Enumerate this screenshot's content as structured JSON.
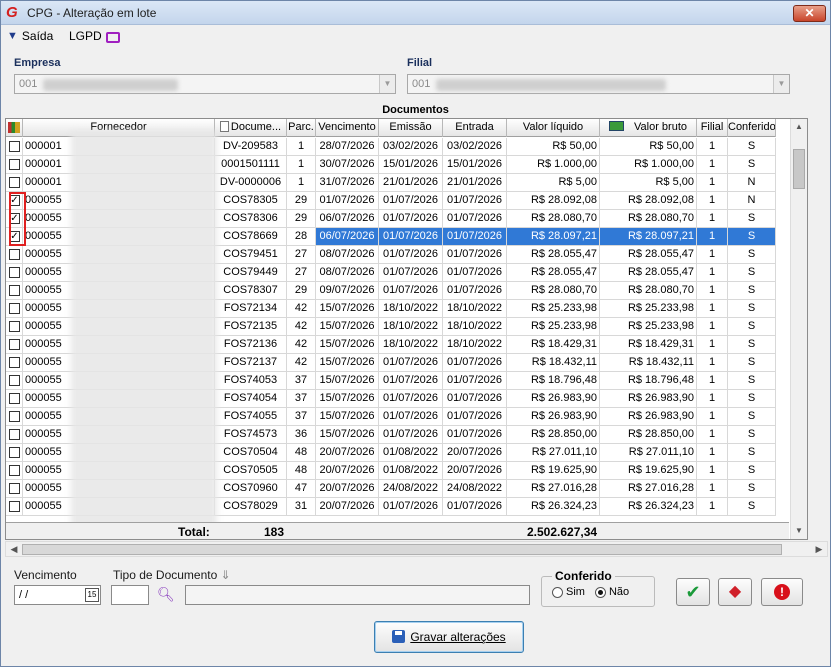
{
  "window": {
    "title": "CPG - Alteração em lote",
    "close_label": "✕",
    "app_icon_glyph": "G"
  },
  "menu": {
    "exit_label": "Saída",
    "lgpd_label": "LGPD"
  },
  "empresa": {
    "label": "Empresa",
    "value": "001"
  },
  "filial": {
    "label": "Filial",
    "value": "001"
  },
  "section_title": "Documentos",
  "table": {
    "headers": {
      "fornecedor": "Fornecedor",
      "documento": "Docume...",
      "parc": "Parc.",
      "vencimento": "Vencimento",
      "emissao": "Emissão",
      "entrada": "Entrada",
      "valor_liquido": "Valor líquido",
      "valor_bruto": "Valor bruto",
      "filial": "Filial",
      "conferido": "Conferido"
    },
    "rows": [
      {
        "checked": false,
        "forn": "000001",
        "doc": "DV-209583",
        "parc": "1",
        "venc": "28/07/2026",
        "emis": "03/02/2026",
        "entr": "03/02/2026",
        "vliq": "R$ 50,00",
        "vbru": "R$ 50,00",
        "fil": "1",
        "conf": "S"
      },
      {
        "checked": false,
        "forn": "000001",
        "doc": "0001501111",
        "parc": "1",
        "venc": "30/07/2026",
        "emis": "15/01/2026",
        "entr": "15/01/2026",
        "vliq": "R$ 1.000,00",
        "vbru": "R$ 1.000,00",
        "fil": "1",
        "conf": "S"
      },
      {
        "checked": false,
        "forn": "000001",
        "doc": "DV-0000006",
        "parc": "1",
        "venc": "31/07/2026",
        "emis": "21/01/2026",
        "entr": "21/01/2026",
        "vliq": "R$ 5,00",
        "vbru": "R$ 5,00",
        "fil": "1",
        "conf": "N"
      },
      {
        "checked": true,
        "forn": "000055",
        "doc": "COS78305",
        "parc": "29",
        "venc": "01/07/2026",
        "emis": "01/07/2026",
        "entr": "01/07/2026",
        "vliq": "R$ 28.092,08",
        "vbru": "R$ 28.092,08",
        "fil": "1",
        "conf": "N"
      },
      {
        "checked": true,
        "forn": "000055",
        "doc": "COS78306",
        "parc": "29",
        "venc": "06/07/2026",
        "emis": "01/07/2026",
        "entr": "01/07/2026",
        "vliq": "R$ 28.080,70",
        "vbru": "R$ 28.080,70",
        "fil": "1",
        "conf": "S"
      },
      {
        "checked": true,
        "selected": true,
        "forn": "000055",
        "doc": "COS78669",
        "parc": "28",
        "venc": "06/07/2026",
        "emis": "01/07/2026",
        "entr": "01/07/2026",
        "vliq": "R$ 28.097,21",
        "vbru": "R$ 28.097,21",
        "fil": "1",
        "conf": "S"
      },
      {
        "checked": false,
        "forn": "000055",
        "doc": "COS79451",
        "parc": "27",
        "venc": "08/07/2026",
        "emis": "01/07/2026",
        "entr": "01/07/2026",
        "vliq": "R$ 28.055,47",
        "vbru": "R$ 28.055,47",
        "fil": "1",
        "conf": "S"
      },
      {
        "checked": false,
        "forn": "000055",
        "doc": "COS79449",
        "parc": "27",
        "venc": "08/07/2026",
        "emis": "01/07/2026",
        "entr": "01/07/2026",
        "vliq": "R$ 28.055,47",
        "vbru": "R$ 28.055,47",
        "fil": "1",
        "conf": "S"
      },
      {
        "checked": false,
        "forn": "000055",
        "doc": "COS78307",
        "parc": "29",
        "venc": "09/07/2026",
        "emis": "01/07/2026",
        "entr": "01/07/2026",
        "vliq": "R$ 28.080,70",
        "vbru": "R$ 28.080,70",
        "fil": "1",
        "conf": "S"
      },
      {
        "checked": false,
        "forn": "000055",
        "doc": "FOS72134",
        "parc": "42",
        "venc": "15/07/2026",
        "emis": "18/10/2022",
        "entr": "18/10/2022",
        "vliq": "R$ 25.233,98",
        "vbru": "R$ 25.233,98",
        "fil": "1",
        "conf": "S"
      },
      {
        "checked": false,
        "forn": "000055",
        "doc": "FOS72135",
        "parc": "42",
        "venc": "15/07/2026",
        "emis": "18/10/2022",
        "entr": "18/10/2022",
        "vliq": "R$ 25.233,98",
        "vbru": "R$ 25.233,98",
        "fil": "1",
        "conf": "S"
      },
      {
        "checked": false,
        "forn": "000055",
        "doc": "FOS72136",
        "parc": "42",
        "venc": "15/07/2026",
        "emis": "18/10/2022",
        "entr": "18/10/2022",
        "vliq": "R$ 18.429,31",
        "vbru": "R$ 18.429,31",
        "fil": "1",
        "conf": "S"
      },
      {
        "checked": false,
        "forn": "000055",
        "doc": "FOS72137",
        "parc": "42",
        "venc": "15/07/2026",
        "emis": "01/07/2026",
        "entr": "01/07/2026",
        "vliq": "R$ 18.432,11",
        "vbru": "R$ 18.432,11",
        "fil": "1",
        "conf": "S"
      },
      {
        "checked": false,
        "forn": "000055",
        "doc": "FOS74053",
        "parc": "37",
        "venc": "15/07/2026",
        "emis": "01/07/2026",
        "entr": "01/07/2026",
        "vliq": "R$ 18.796,48",
        "vbru": "R$ 18.796,48",
        "fil": "1",
        "conf": "S"
      },
      {
        "checked": false,
        "forn": "000055",
        "doc": "FOS74054",
        "parc": "37",
        "venc": "15/07/2026",
        "emis": "01/07/2026",
        "entr": "01/07/2026",
        "vliq": "R$ 26.983,90",
        "vbru": "R$ 26.983,90",
        "fil": "1",
        "conf": "S"
      },
      {
        "checked": false,
        "forn": "000055",
        "doc": "FOS74055",
        "parc": "37",
        "venc": "15/07/2026",
        "emis": "01/07/2026",
        "entr": "01/07/2026",
        "vliq": "R$ 26.983,90",
        "vbru": "R$ 26.983,90",
        "fil": "1",
        "conf": "S"
      },
      {
        "checked": false,
        "forn": "000055",
        "doc": "FOS74573",
        "parc": "36",
        "venc": "15/07/2026",
        "emis": "01/07/2026",
        "entr": "01/07/2026",
        "vliq": "R$ 28.850,00",
        "vbru": "R$ 28.850,00",
        "fil": "1",
        "conf": "S"
      },
      {
        "checked": false,
        "forn": "000055",
        "doc": "COS70504",
        "parc": "48",
        "venc": "20/07/2026",
        "emis": "01/08/2022",
        "entr": "20/07/2026",
        "vliq": "R$ 27.011,10",
        "vbru": "R$ 27.011,10",
        "fil": "1",
        "conf": "S"
      },
      {
        "checked": false,
        "forn": "000055",
        "doc": "COS70505",
        "parc": "48",
        "venc": "20/07/2026",
        "emis": "01/08/2022",
        "entr": "20/07/2026",
        "vliq": "R$ 19.625,90",
        "vbru": "R$ 19.625,90",
        "fil": "1",
        "conf": "S"
      },
      {
        "checked": false,
        "forn": "000055",
        "doc": "COS70960",
        "parc": "47",
        "venc": "20/07/2026",
        "emis": "24/08/2022",
        "entr": "24/08/2022",
        "vliq": "R$ 27.016,28",
        "vbru": "R$ 27.016,28",
        "fil": "1",
        "conf": "S"
      },
      {
        "checked": false,
        "forn": "000055",
        "doc": "COS78029",
        "parc": "31",
        "venc": "20/07/2026",
        "emis": "01/07/2026",
        "entr": "01/07/2026",
        "vliq": "R$ 26.324,23",
        "vbru": "R$ 26.324,23",
        "fil": "1",
        "conf": "S"
      }
    ],
    "total_label": "Total:",
    "total_count": "183",
    "total_value": "2.502.627,34"
  },
  "filters": {
    "vencimento_label": "Vencimento",
    "vencimento_value": " / /",
    "tipo_doc_label": "Tipo de Documento",
    "tipo_doc_value": "",
    "conferido_label": "Conferido",
    "sim_label": "Sim",
    "nao_label": "Não",
    "conferido_selected": "Não"
  },
  "buttons": {
    "save_label": "Gravar alterações"
  },
  "colors": {
    "selected_row": "#3079d6",
    "highlight_border": "#e02020"
  }
}
